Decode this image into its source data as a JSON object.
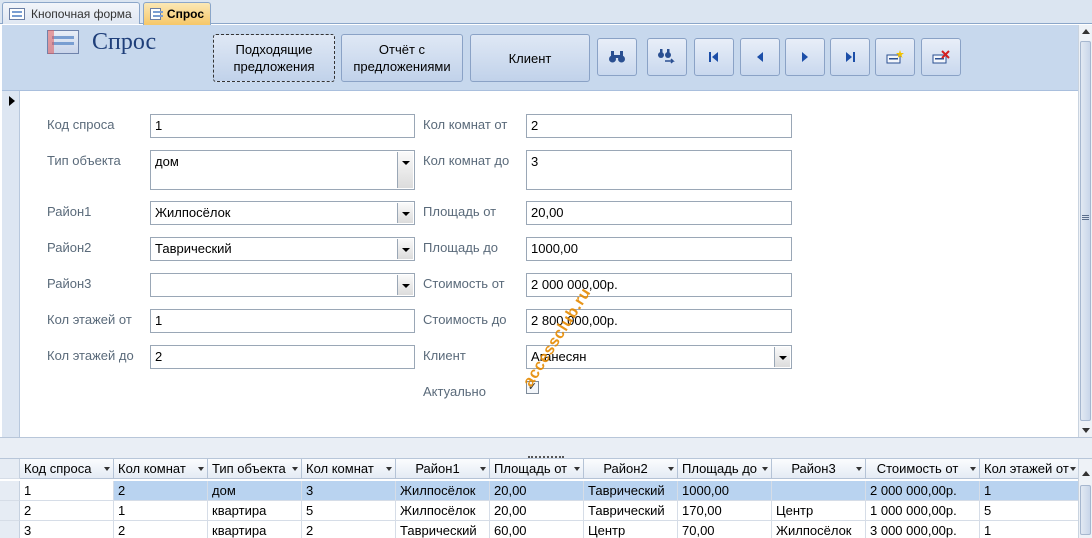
{
  "tabs": [
    {
      "label": "Кнопочная форма",
      "active": false
    },
    {
      "label": "Спрос",
      "active": true
    }
  ],
  "header": {
    "title": "Спрос",
    "buttons": {
      "matching": "Подходящие предложения",
      "report": "Отчёт с предложениями",
      "client": "Клиент"
    },
    "nav_icons": [
      "find-icon",
      "find-replace-icon",
      "first-record-icon",
      "previous-record-icon",
      "next-record-icon",
      "last-record-icon",
      "new-record-icon",
      "delete-record-icon"
    ]
  },
  "form": {
    "left": [
      {
        "label": "Код спроса",
        "value": "1",
        "type": "text"
      },
      {
        "label": "Тип объекта",
        "value": "дом",
        "type": "combo"
      },
      {
        "label": "Район1",
        "value": "Жилпосёлок",
        "type": "combo"
      },
      {
        "label": "Район2",
        "value": "Таврический",
        "type": "combo"
      },
      {
        "label": "Район3",
        "value": "",
        "type": "combo"
      },
      {
        "label": "Кол этажей от",
        "value": "1",
        "type": "text"
      },
      {
        "label": "Кол этажей до",
        "value": "2",
        "type": "text"
      }
    ],
    "right": [
      {
        "label": "Кол комнат от",
        "value": "2",
        "type": "text"
      },
      {
        "label": "Кол комнат до",
        "value": "3",
        "type": "text"
      },
      {
        "label": "Площадь от",
        "value": "20,00",
        "type": "text"
      },
      {
        "label": "Площадь до",
        "value": "1000,00",
        "type": "text"
      },
      {
        "label": "Стоимость от",
        "value": "2 000 000,00р.",
        "type": "text"
      },
      {
        "label": "Стоимость до",
        "value": "2 800 000,00р.",
        "type": "text"
      },
      {
        "label": "Клиент",
        "value": "Аганесян",
        "type": "combo"
      }
    ],
    "actual": {
      "label": "Актуально",
      "checked": true
    }
  },
  "watermark": "accessclub.ru",
  "datasheet": {
    "columns": [
      "Код спроса",
      "Кол комнат",
      "Тип объекта",
      "Кол комнат",
      "Район1",
      "Площадь от",
      "Район2",
      "Площадь до",
      "Район3",
      "Стоимость от",
      "Кол этажей от"
    ],
    "rows": [
      [
        "1",
        "2",
        "дом",
        "3",
        "Жилпосёлок",
        "20,00",
        "Таврический",
        "1000,00",
        "",
        "2 000 000,00р.",
        "1"
      ],
      [
        "2",
        "1",
        "квартира",
        "5",
        "Жилпосёлок",
        "20,00",
        "Таврический",
        "170,00",
        "Центр",
        "1 000 000,00р.",
        "5"
      ],
      [
        "3",
        "2",
        "квартира",
        "2",
        "Таврический",
        "60,00",
        "Центр",
        "70,00",
        "Жилпосёлок",
        "3 000 000,00р.",
        "1"
      ]
    ]
  },
  "colors": {
    "header_bg": "#c7d8ed",
    "active_tab": "#f6c768",
    "title": "#1f3f7a",
    "selected_row": "#b9d3f0",
    "watermark": "#e68a00"
  }
}
